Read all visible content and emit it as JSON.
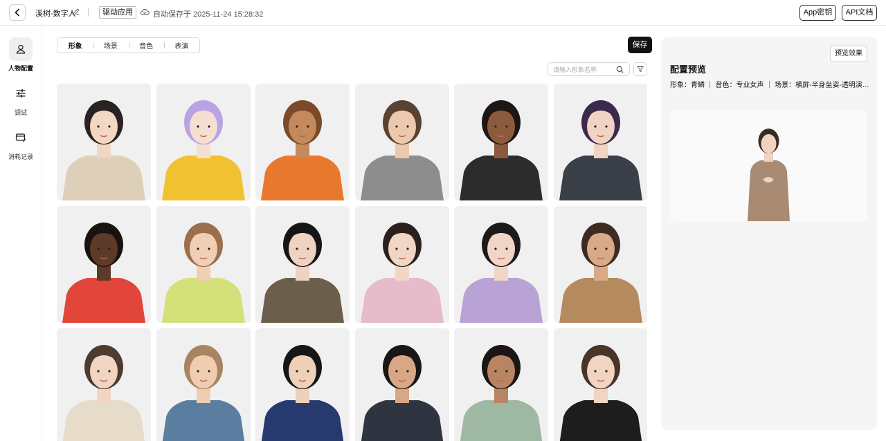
{
  "header": {
    "project_name": "溪树-数字人",
    "app_badge": "驱动应用",
    "autosave_text": "自动保存于 2025-11-24 15:28:32",
    "app_key_label": "App密钥",
    "api_doc_label": "API文档"
  },
  "sidebar": {
    "items": [
      {
        "label": "人物配置",
        "icon": "person-icon",
        "active": true
      },
      {
        "label": "调试",
        "icon": "sliders-icon",
        "active": false
      },
      {
        "label": "消耗记录",
        "icon": "wallet-icon",
        "active": false
      }
    ]
  },
  "tabs": [
    {
      "label": "形象",
      "active": true
    },
    {
      "label": "场景",
      "active": false
    },
    {
      "label": "音色",
      "active": false
    },
    {
      "label": "表演",
      "active": false
    }
  ],
  "toolbar": {
    "save_label": "保存"
  },
  "search": {
    "placeholder": "请输入形象名称"
  },
  "avatars": [
    {
      "skin": "#f1d7c4",
      "hair": "#2a2220",
      "outfit": "#ddcfb8"
    },
    {
      "skin": "#f6dfd2",
      "hair": "#b9a2e6",
      "outfit": "#f0c232"
    },
    {
      "skin": "#c48a5b",
      "hair": "#7b4a2b",
      "outfit": "#e8782e"
    },
    {
      "skin": "#ecc9ad",
      "hair": "#5a4232",
      "outfit": "#8d8d8d"
    },
    {
      "skin": "#8c5a3c",
      "hair": "#1d1614",
      "outfit": "#2c2c2c"
    },
    {
      "skin": "#f0d3c2",
      "hair": "#3b2a4e",
      "outfit": "#3a3f48"
    },
    {
      "skin": "#5e3a28",
      "hair": "#181210",
      "outfit": "#e2463a"
    },
    {
      "skin": "#f0cfb5",
      "hair": "#9a6f4e",
      "outfit": "#d4e07a"
    },
    {
      "skin": "#efd3c2",
      "hair": "#151515",
      "outfit": "#6b5e4a"
    },
    {
      "skin": "#f1d6c6",
      "hair": "#2a211e",
      "outfit": "#e6bccb"
    },
    {
      "skin": "#f1d6c8",
      "hair": "#1c1a1a",
      "outfit": "#b9a3d6"
    },
    {
      "skin": "#d9a988",
      "hair": "#3d2b22",
      "outfit": "#b48a5e"
    },
    {
      "skin": "#f0d5c3",
      "hair": "#4e3a2e",
      "outfit": "#e7dcc9"
    },
    {
      "skin": "#f0cdb1",
      "hair": "#a88462",
      "outfit": "#5b7ea0"
    },
    {
      "skin": "#efd0b9",
      "hair": "#161616",
      "outfit": "#263a6e"
    },
    {
      "skin": "#d8a886",
      "hair": "#1a1614",
      "outfit": "#2f3540"
    },
    {
      "skin": "#b98462",
      "hair": "#1b1614",
      "outfit": "#9fb8a4"
    },
    {
      "skin": "#f1d4c2",
      "hair": "#4a3428",
      "outfit": "#1d1d1d"
    }
  ],
  "preview": {
    "button_label": "预览效果",
    "title": "配置预览",
    "summary": "形象：青鳞 ｜ 音色：专业女声 ｜ 场景：横屏-半身坐姿-透明演播室...",
    "figure": {
      "skin": "#efd2bf",
      "hair": "#3a2a22",
      "outfit": "#a98a72"
    }
  }
}
